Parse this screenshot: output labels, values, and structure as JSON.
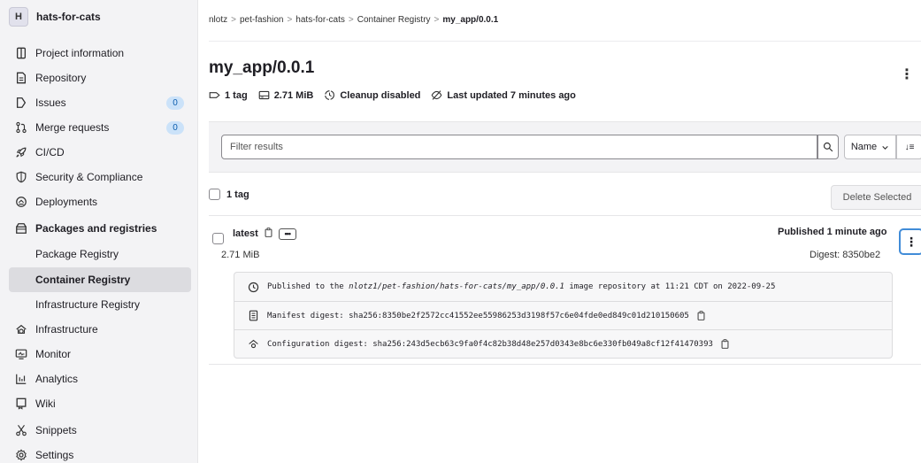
{
  "sidebar": {
    "avatar": "H",
    "project_name": "hats-for-cats",
    "items": [
      {
        "label": "Project information",
        "icon": "info-icon"
      },
      {
        "label": "Repository",
        "icon": "document-icon"
      },
      {
        "label": "Issues",
        "icon": "issues-icon",
        "badge": "0"
      },
      {
        "label": "Merge requests",
        "icon": "merge-request-icon",
        "badge": "0"
      },
      {
        "label": "CI/CD",
        "icon": "rocket-icon"
      },
      {
        "label": "Security & Compliance",
        "icon": "shield-icon"
      },
      {
        "label": "Deployments",
        "icon": "deployments-icon"
      },
      {
        "label": "Packages and registries",
        "icon": "package-icon"
      },
      {
        "label": "Package Registry"
      },
      {
        "label": "Container Registry"
      },
      {
        "label": "Infrastructure Registry"
      },
      {
        "label": "Infrastructure",
        "icon": "cloud-gear-icon"
      },
      {
        "label": "Monitor",
        "icon": "monitor-icon"
      },
      {
        "label": "Analytics",
        "icon": "chart-icon"
      },
      {
        "label": "Wiki",
        "icon": "book-icon"
      },
      {
        "label": "Snippets",
        "icon": "scissors-icon"
      },
      {
        "label": "Settings",
        "icon": "gear-icon"
      }
    ]
  },
  "breadcrumb": {
    "items": [
      "nlotz",
      "pet-fashion",
      "hats-for-cats",
      "Container Registry"
    ],
    "current": "my_app/0.0.1",
    "separator": ">"
  },
  "header": {
    "title": "my_app/0.0.1",
    "more": "⋮",
    "meta": {
      "tags": "1 tag",
      "size": "2.71 MiB",
      "cleanup": "Cleanup disabled",
      "updated": "Last updated 7 minutes ago"
    }
  },
  "filter": {
    "placeholder": "Filter results",
    "sort_label": "Name",
    "sort_dir": "↓≡"
  },
  "list": {
    "count_label": "1 tag",
    "delete_label": "Delete Selected"
  },
  "tag": {
    "name": "latest",
    "more": "•••",
    "size": "2.71 MiB",
    "published": "Published 1 minute ago",
    "digest": "Digest: 8350be2",
    "menu": "⋮",
    "details": {
      "published_prefix": "Published to the ",
      "repo_path": "nlotz1/pet-fashion/hats-for-cats/my_app/0.0.1",
      "published_suffix": " image repository at 11:21 CDT on 2022-09-25",
      "manifest": "Manifest digest: sha256:8350be2f2572cc41552ee55986253d3198f57c6e04fde0ed849c01d210150605",
      "config": "Configuration digest: sha256:243d5ecb63c9fa0f4c82b38d48e257d0343e8bc6e330fb049a8cf12f41470393"
    }
  },
  "colors": {
    "sidebar_bg": "#f3f3f5",
    "active_item_bg": "#dcdce0",
    "badge_bg": "#cbe2f9",
    "focus_blue": "#418cd8"
  }
}
